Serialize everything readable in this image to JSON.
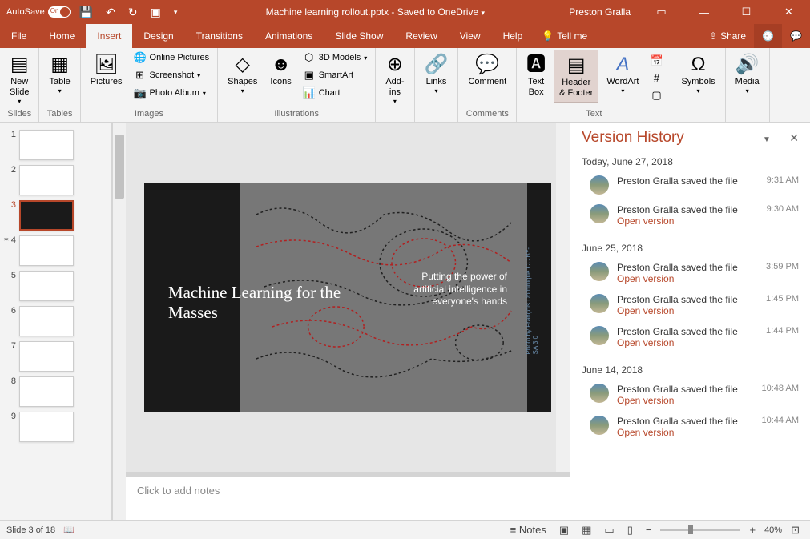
{
  "titlebar": {
    "autosave": "AutoSave",
    "autosave_state": "On",
    "filename": "Machine learning rollout.pptx",
    "saved_status": "Saved to OneDrive",
    "user": "Preston Gralla"
  },
  "tabs": {
    "file": "File",
    "home": "Home",
    "insert": "Insert",
    "design": "Design",
    "transitions": "Transitions",
    "animations": "Animations",
    "slideshow": "Slide Show",
    "review": "Review",
    "view": "View",
    "help": "Help",
    "tellme": "Tell me",
    "share": "Share"
  },
  "ribbon": {
    "new_slide": "New\nSlide",
    "table": "Table",
    "pictures": "Pictures",
    "online_pictures": "Online Pictures",
    "screenshot": "Screenshot",
    "photo_album": "Photo Album",
    "shapes": "Shapes",
    "icons": "Icons",
    "models3d": "3D Models",
    "smartart": "SmartArt",
    "chart": "Chart",
    "addins": "Add-\nins",
    "links": "Links",
    "comment": "Comment",
    "textbox": "Text\nBox",
    "header_footer": "Header\n& Footer",
    "wordart": "WordArt",
    "symbols": "Symbols",
    "media": "Media",
    "groups": {
      "slides": "Slides",
      "tables": "Tables",
      "images": "Images",
      "illustrations": "Illustrations",
      "comments": "Comments",
      "text": "Text"
    }
  },
  "slide": {
    "title": "Machine Learning for the Masses",
    "subtitle": "Putting the power of artificial intelligence in everyone's hands",
    "credit": "Photo by François Dominique CC BY-SA 3.0"
  },
  "notes": {
    "placeholder": "Click to add notes"
  },
  "version_history": {
    "title": "Version History",
    "dates": [
      {
        "label": "Today, June 27, 2018",
        "entries": [
          {
            "text": "Preston Gralla saved the file",
            "time": "9:31 AM",
            "link": null
          },
          {
            "text": "Preston Gralla saved the file",
            "time": "9:30 AM",
            "link": "Open version"
          }
        ]
      },
      {
        "label": "June 25, 2018",
        "entries": [
          {
            "text": "Preston Gralla saved the file",
            "time": "3:59 PM",
            "link": "Open version"
          },
          {
            "text": "Preston Gralla saved the file",
            "time": "1:45 PM",
            "link": "Open version"
          },
          {
            "text": "Preston Gralla saved the file",
            "time": "1:44 PM",
            "link": "Open version"
          }
        ]
      },
      {
        "label": "June 14, 2018",
        "entries": [
          {
            "text": "Preston Gralla saved the file",
            "time": "10:48 AM",
            "link": "Open version"
          },
          {
            "text": "Preston Gralla saved the file",
            "time": "10:44 AM",
            "link": "Open version"
          }
        ]
      }
    ]
  },
  "statusbar": {
    "slide_info": "Slide 3 of 18",
    "notes_btn": "Notes",
    "zoom": "40%"
  },
  "thumbnails": [
    {
      "num": "1",
      "sel": false,
      "dark": false
    },
    {
      "num": "2",
      "sel": false,
      "dark": false
    },
    {
      "num": "3",
      "sel": true,
      "dark": true
    },
    {
      "num": "4",
      "sel": false,
      "dark": false
    },
    {
      "num": "5",
      "sel": false,
      "dark": false
    },
    {
      "num": "6",
      "sel": false,
      "dark": false
    },
    {
      "num": "7",
      "sel": false,
      "dark": false
    },
    {
      "num": "8",
      "sel": false,
      "dark": false
    },
    {
      "num": "9",
      "sel": false,
      "dark": false
    }
  ]
}
